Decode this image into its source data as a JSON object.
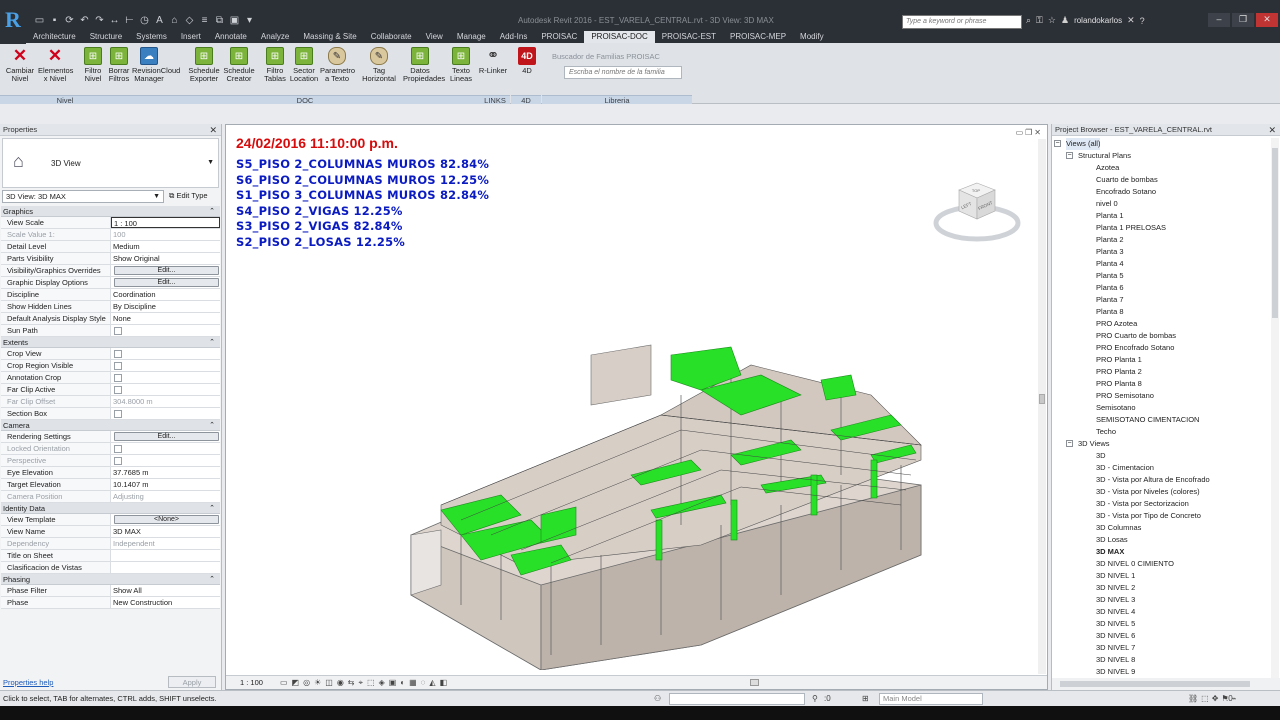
{
  "app": {
    "title": "Autodesk Revit 2016 -  EST_VARELA_CENTRAL.rvt - 3D View: 3D MAX",
    "search_placeholder": "Type a keyword or phrase",
    "user": "rolandokarlos"
  },
  "tabs": [
    "Architecture",
    "Structure",
    "Systems",
    "Insert",
    "Annotate",
    "Analyze",
    "Massing & Site",
    "Collaborate",
    "View",
    "Manage",
    "Add-Ins",
    "PROISAC",
    "PROISAC-DOC",
    "PROISAC-EST",
    "PROISAC-MEP",
    "Modify"
  ],
  "active_tab": "PROISAC-DOC",
  "ribbon": {
    "buttons": [
      {
        "label": "Cambiar\nNivel",
        "icon": "x"
      },
      {
        "label": "Elementos\nx Nivel",
        "icon": "x"
      },
      {
        "label": "Filtro\nNivel",
        "icon": "g"
      },
      {
        "label": "Borrar\nFiltros",
        "icon": "g"
      },
      {
        "label": "RevisionCloud\nManager",
        "icon": "b"
      },
      {
        "label": "Schedule\nExporter",
        "icon": "g"
      },
      {
        "label": "Schedule\nCreator",
        "icon": "g"
      },
      {
        "label": "Filtro\nTablas",
        "icon": "g"
      },
      {
        "label": "Sector\nLocation",
        "icon": "g"
      },
      {
        "label": "Parametro\na Texto",
        "icon": "p"
      },
      {
        "label": "Tag\nHorizontal",
        "icon": "p"
      },
      {
        "label": "Datos\nPropiedades",
        "icon": "g"
      },
      {
        "label": "Texto\nLineas",
        "icon": "g"
      },
      {
        "label": "R-Linker",
        "icon": "k"
      },
      {
        "label": "4D",
        "icon": "r4"
      }
    ],
    "panels": [
      "Nivel",
      "DOC",
      "LINKS",
      "4D",
      "Libreria"
    ],
    "family_search": {
      "title": "Buscador de Familias PROISAC",
      "placeholder": "Escriba el nombre de la familia"
    }
  },
  "properties": {
    "header": "Properties",
    "type_name": "3D View",
    "instance": "3D View: 3D MAX",
    "edit_type": "Edit Type",
    "sections": [
      {
        "name": "Graphics",
        "rows": [
          {
            "k": "View Scale",
            "v": "1 : 100",
            "t": "sel"
          },
          {
            "k": "Scale Value    1:",
            "v": "100",
            "t": "dis"
          },
          {
            "k": "Detail Level",
            "v": "Medium"
          },
          {
            "k": "Parts Visibility",
            "v": "Show Original"
          },
          {
            "k": "Visibility/Graphics Overrides",
            "v": "Edit...",
            "t": "btn"
          },
          {
            "k": "Graphic Display Options",
            "v": "Edit...",
            "t": "btn"
          },
          {
            "k": "Discipline",
            "v": "Coordination"
          },
          {
            "k": "Show Hidden Lines",
            "v": "By Discipline"
          },
          {
            "k": "Default Analysis Display Style",
            "v": "None"
          },
          {
            "k": "Sun Path",
            "v": "",
            "t": "chk"
          }
        ]
      },
      {
        "name": "Extents",
        "rows": [
          {
            "k": "Crop View",
            "v": "",
            "t": "chk"
          },
          {
            "k": "Crop Region Visible",
            "v": "",
            "t": "chk"
          },
          {
            "k": "Annotation Crop",
            "v": "",
            "t": "chk"
          },
          {
            "k": "Far Clip Active",
            "v": "",
            "t": "chk"
          },
          {
            "k": "Far Clip Offset",
            "v": "304.8000 m",
            "t": "dis"
          },
          {
            "k": "Section Box",
            "v": "",
            "t": "chk"
          }
        ]
      },
      {
        "name": "Camera",
        "rows": [
          {
            "k": "Rendering Settings",
            "v": "Edit...",
            "t": "btn"
          },
          {
            "k": "Locked Orientation",
            "v": "",
            "t": "dischk"
          },
          {
            "k": "Perspective",
            "v": "",
            "t": "dischk"
          },
          {
            "k": "Eye Elevation",
            "v": "37.7685 m"
          },
          {
            "k": "Target Elevation",
            "v": "10.1407 m"
          },
          {
            "k": "Camera Position",
            "v": "Adjusting",
            "t": "dis"
          }
        ]
      },
      {
        "name": "Identity Data",
        "rows": [
          {
            "k": "View Template",
            "v": "<None>",
            "t": "btn"
          },
          {
            "k": "View Name",
            "v": "3D MAX"
          },
          {
            "k": "Dependency",
            "v": "Independent",
            "t": "dis"
          },
          {
            "k": "Title on Sheet",
            "v": ""
          },
          {
            "k": "Clasificacion de Vistas",
            "v": ""
          }
        ]
      },
      {
        "name": "Phasing",
        "rows": [
          {
            "k": "Phase Filter",
            "v": "Show All"
          },
          {
            "k": "Phase",
            "v": "New Construction"
          }
        ]
      }
    ],
    "help": "Properties help",
    "apply": "Apply"
  },
  "view": {
    "timestamp": "24/02/2016 11:10:00 p.m.",
    "notes": [
      "S5_PISO 2_COLUMNAS MUROS 82.84%",
      "S6_PISO 2_COLUMNAS MUROS 12.25%",
      "S1_PISO 3_COLUMNAS MUROS 82.84%",
      "S4_PISO 2_VIGAS 12.25%",
      "S3_PISO 2_VIGAS 82.84%",
      "S2_PISO 2_LOSAS 12.25%"
    ],
    "scale": "1 : 100",
    "viewcube": {
      "top": "TOP",
      "left": "LEFT",
      "front": "FRONT"
    },
    "progress_color": "#28e028"
  },
  "browser": {
    "header": "Project Browser - EST_VARELA_CENTRAL.rvt",
    "nodes": [
      {
        "label": "Views (all)",
        "lvl": 0,
        "tog": "-"
      },
      {
        "label": "Structural Plans",
        "lvl": 1,
        "tog": "-"
      },
      {
        "label": "Azotea",
        "lvl": 2
      },
      {
        "label": "Cuarto de bombas",
        "lvl": 2
      },
      {
        "label": "Encofrado Sotano",
        "lvl": 2
      },
      {
        "label": "nivel 0",
        "lvl": 2
      },
      {
        "label": "Planta 1",
        "lvl": 2
      },
      {
        "label": "Planta 1 PRELOSAS",
        "lvl": 2
      },
      {
        "label": "Planta 2",
        "lvl": 2
      },
      {
        "label": "Planta 3",
        "lvl": 2
      },
      {
        "label": "Planta 4",
        "lvl": 2
      },
      {
        "label": "Planta 5",
        "lvl": 2
      },
      {
        "label": "Planta 6",
        "lvl": 2
      },
      {
        "label": "Planta 7",
        "lvl": 2
      },
      {
        "label": "Planta 8",
        "lvl": 2
      },
      {
        "label": "PRO Azotea",
        "lvl": 2
      },
      {
        "label": "PRO Cuarto de bombas",
        "lvl": 2
      },
      {
        "label": "PRO Encofrado Sotano",
        "lvl": 2
      },
      {
        "label": "PRO Planta 1",
        "lvl": 2
      },
      {
        "label": "PRO Planta 2",
        "lvl": 2
      },
      {
        "label": "PRO Planta 8",
        "lvl": 2
      },
      {
        "label": "PRO Semisotano",
        "lvl": 2
      },
      {
        "label": "Semisotano",
        "lvl": 2
      },
      {
        "label": "SEMISOTANO CIMENTACION",
        "lvl": 2
      },
      {
        "label": "Techo",
        "lvl": 2
      },
      {
        "label": "3D Views",
        "lvl": 1,
        "tog": "-"
      },
      {
        "label": "3D",
        "lvl": 2
      },
      {
        "label": "3D - Cimentacion",
        "lvl": 2
      },
      {
        "label": "3D - Vista por Altura de Encofrado",
        "lvl": 2
      },
      {
        "label": "3D - Vista por Niveles (colores)",
        "lvl": 2
      },
      {
        "label": "3D - Vista por Sectorizacion",
        "lvl": 2
      },
      {
        "label": "3D - Vista por Tipo de Concreto",
        "lvl": 2
      },
      {
        "label": "3D Columnas",
        "lvl": 2
      },
      {
        "label": "3D Losas",
        "lvl": 2
      },
      {
        "label": "3D MAX",
        "lvl": 2,
        "bold": true
      },
      {
        "label": "3D NIVEL 0 CIMIENTO",
        "lvl": 2
      },
      {
        "label": "3D NIVEL 1",
        "lvl": 2
      },
      {
        "label": "3D NIVEL 2",
        "lvl": 2
      },
      {
        "label": "3D NIVEL 3",
        "lvl": 2
      },
      {
        "label": "3D NIVEL 4",
        "lvl": 2
      },
      {
        "label": "3D NIVEL 5",
        "lvl": 2
      },
      {
        "label": "3D NIVEL 6",
        "lvl": 2
      },
      {
        "label": "3D NIVEL 7",
        "lvl": 2
      },
      {
        "label": "3D NIVEL 8",
        "lvl": 2
      },
      {
        "label": "3D NIVEL 9",
        "lvl": 2
      }
    ]
  },
  "status": {
    "message": "Click to select, TAB for alternates, CTRL adds, SHIFT unselects.",
    "workset_count": ":0",
    "design_option": "Main Model",
    "filter_count": ":0"
  }
}
